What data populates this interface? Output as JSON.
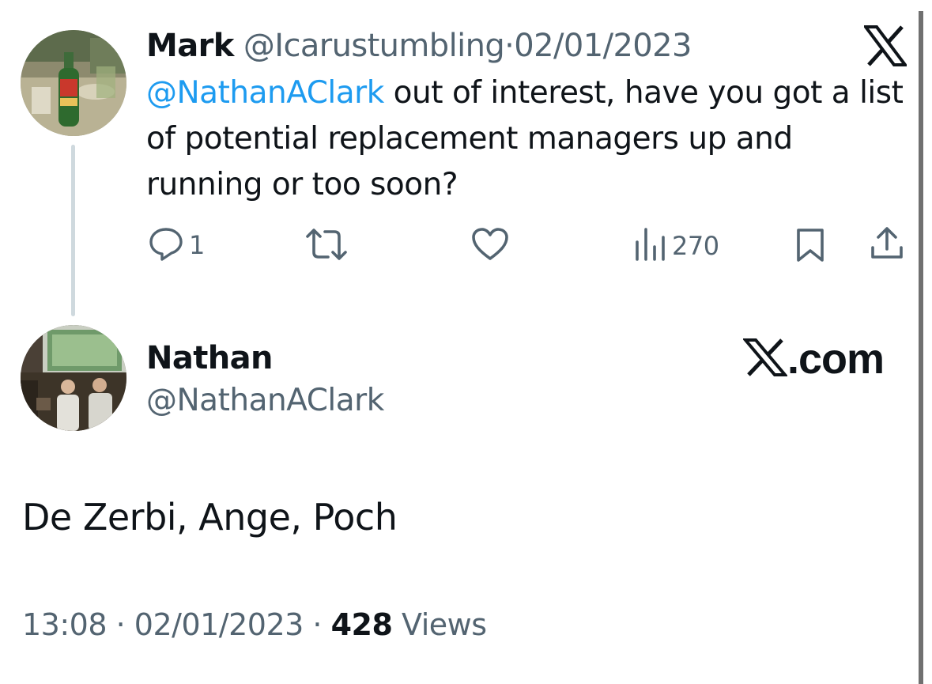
{
  "reply_tweet": {
    "author_name": "Mark",
    "author_handle": "@Icarustumbling",
    "separator": "·",
    "date": "02/01/2023",
    "mention": "@NathanAClark",
    "text": " out of interest, have you got a list of potential replacement managers up and running or too soon?",
    "actions": {
      "reply_count": "1",
      "retweet_count": "",
      "like_count": "",
      "views_count": "270"
    }
  },
  "main_tweet": {
    "author_name": "Nathan",
    "author_handle": "@NathanAClark",
    "text": "De Zerbi, Ange, Poch",
    "time": "13:08",
    "separator": "·",
    "date": "02/01/2023",
    "views_count": "428",
    "views_label": "Views"
  },
  "branding": {
    "site": ".com"
  },
  "icons": {
    "reply_x_logo": "x-logo-icon",
    "brand_x_logo": "x-logo-icon",
    "reply": "reply-bubble-icon",
    "retweet": "retweet-icon",
    "like": "heart-icon",
    "views": "bar-chart-icon",
    "bookmark": "bookmark-icon",
    "share": "share-icon"
  },
  "colors": {
    "text": "#0f1419",
    "secondary": "#536471",
    "link": "#1d9bf0",
    "thread_line": "#cfd9de"
  }
}
